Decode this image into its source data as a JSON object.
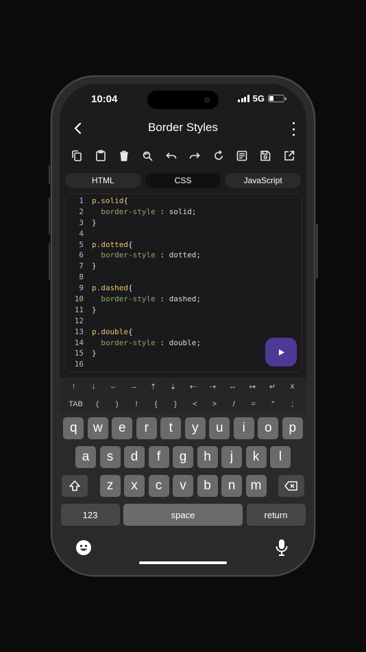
{
  "status": {
    "time": "10:04",
    "network": "5G"
  },
  "header": {
    "title": "Border Styles"
  },
  "toolbar": {
    "icons": [
      "copy-icon",
      "paste-icon",
      "trash-icon",
      "find-replace-icon",
      "undo-icon",
      "redo-icon",
      "refresh-icon",
      "format-icon",
      "save-icon",
      "open-external-icon"
    ]
  },
  "tabs": [
    "HTML",
    "CSS",
    "JavaScript"
  ],
  "active_tab": "CSS",
  "code": [
    {
      "n": "1",
      "sel": "p.solid",
      "rest": "{"
    },
    {
      "n": "2",
      "prop": "border-style",
      "rest": " : solid;"
    },
    {
      "n": "3",
      "rest": "}"
    },
    {
      "n": "4",
      "rest": ""
    },
    {
      "n": "5",
      "sel": "p.dotted",
      "rest": "{"
    },
    {
      "n": "6",
      "prop": "border-style",
      "rest": " : dotted;"
    },
    {
      "n": "7",
      "rest": "}"
    },
    {
      "n": "8",
      "rest": ""
    },
    {
      "n": "9",
      "sel": "p.dashed",
      "rest": "{"
    },
    {
      "n": "10",
      "prop": "border-style",
      "rest": " : dashed;"
    },
    {
      "n": "11",
      "rest": "}"
    },
    {
      "n": "12",
      "rest": ""
    },
    {
      "n": "13",
      "sel": "p.double",
      "rest": "{"
    },
    {
      "n": "14",
      "prop": "border-style",
      "rest": " : double;"
    },
    {
      "n": "15",
      "rest": "}"
    },
    {
      "n": "16",
      "rest": ""
    }
  ],
  "accessory": {
    "row1": [
      "↑",
      "↓",
      "←",
      "→",
      "⇡",
      "⇣",
      "⇠",
      "⇢",
      "↔",
      "↦",
      "↵",
      "x"
    ],
    "row2": [
      "TAB",
      "(",
      ")",
      "!",
      "{",
      "}",
      "<",
      ">",
      "/",
      "=",
      "\"",
      ";"
    ]
  },
  "keyboard": {
    "row1": [
      "q",
      "w",
      "e",
      "r",
      "t",
      "y",
      "u",
      "i",
      "o",
      "p"
    ],
    "row2": [
      "a",
      "s",
      "d",
      "f",
      "g",
      "h",
      "j",
      "k",
      "l"
    ],
    "row3": [
      "z",
      "x",
      "c",
      "v",
      "b",
      "n",
      "m"
    ],
    "numbers": "123",
    "space": "space",
    "return": "return"
  },
  "colors": {
    "accent": "#4e3a95",
    "selector": "#e8c872",
    "property": "#8faa6a"
  }
}
